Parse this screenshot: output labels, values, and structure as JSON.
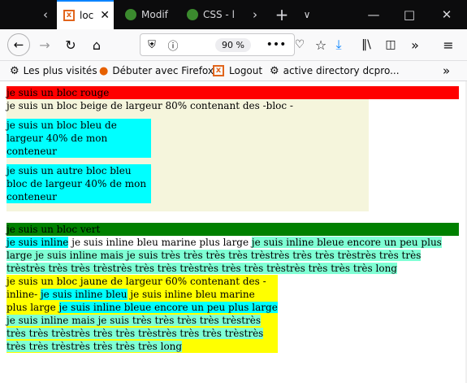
{
  "tabs": [
    {
      "label": "loc",
      "active": true
    },
    {
      "label": "Modif",
      "active": false
    },
    {
      "label": "CSS - l",
      "active": false
    }
  ],
  "toolbar": {
    "zoom": "90 %"
  },
  "bookmarks": [
    {
      "label": "Les plus visités",
      "icon": "gear-icon"
    },
    {
      "label": "Débuter avec Firefox",
      "icon": "firefox-icon"
    },
    {
      "label": "Logout",
      "icon": "xampp-icon"
    },
    {
      "label": "active directory dcpro...",
      "icon": "gear-person-icon"
    }
  ],
  "content": {
    "red_block": "je suis un bloc rouge",
    "beige_block": "je suis un bloc beige de largeur 80% contenant des -bloc -",
    "blue_block_1": "je suis un bloc bleu de largeur 40% de mon conteneur",
    "blue_block_2": "je suis un autre bloc bleu bloc de largeur 40% de mon conteneur",
    "green_block": "je suis un bloc vert",
    "inline_1": "je suis inline",
    "inline_2": " je suis inline bleu marine plus large ",
    "inline_3": "je suis inline bleue encore un peu plus large",
    "inline_4": " je suis inline mais je suis très très très très trèstrès très très trèstrès très très trèstrès très très trèstrès très très trèstrès très très trèstrès très très très long",
    "yellow_intro": "je suis un bloc jaune de largeur 60% contenant des -inline- ",
    "y_inline_1": "je suis inline bleu",
    "y_inline_2": " je suis inline bleu marine plus large ",
    "y_inline_3": "je suis inline bleue encore un peu plus large",
    "y_inline_4": " je suis inline mais je suis très très très très trèstrès très très trèstrès très très trèstrès très très trèstrès très très trèstrès très très très long"
  },
  "colors": {
    "red": "#ff0000",
    "beige": "#f5f5dc",
    "cyan": "#00ffff",
    "green": "#008000",
    "aquamarine": "#7fffd4",
    "yellow": "#ffff00"
  }
}
